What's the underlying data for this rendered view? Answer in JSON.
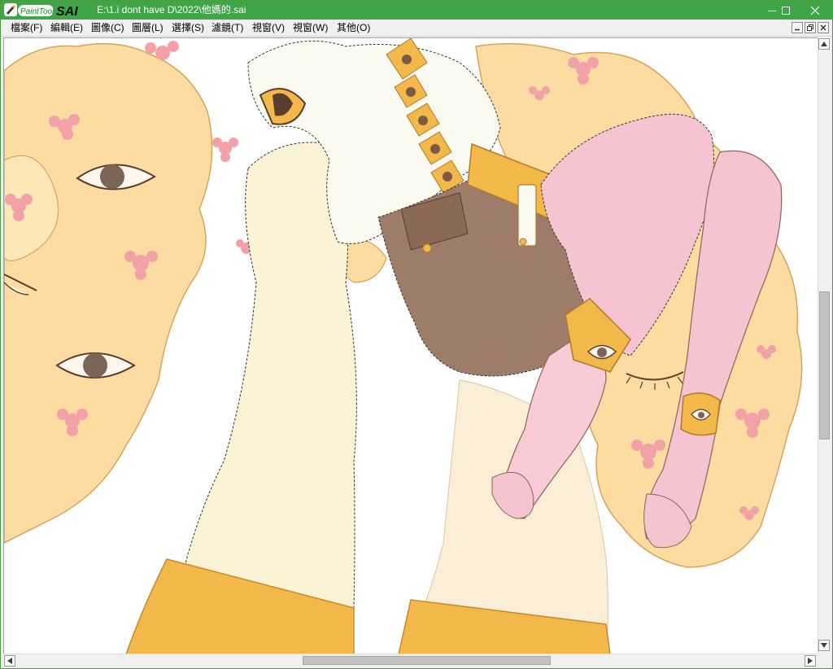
{
  "app": {
    "logo_text": "PaintTool SAI",
    "title": "E:\\1.i dont have D\\2022\\他媽的.sai"
  },
  "window_controls": {
    "minimize_icon": "minimize-icon",
    "maximize_icon": "maximize-icon",
    "close_icon": "close-icon"
  },
  "menu": {
    "items": [
      {
        "label": "檔案(F)"
      },
      {
        "label": "編輯(E)"
      },
      {
        "label": "圖像(C)"
      },
      {
        "label": "圖層(L)"
      },
      {
        "label": "選擇(S)"
      },
      {
        "label": "濾鏡(T)"
      },
      {
        "label": "視窗(V)"
      },
      {
        "label": "視窗(W)"
      },
      {
        "label": "其他(O)"
      }
    ]
  },
  "canvas": {
    "description_icon": "artwork-canvas"
  },
  "scrollbars": {
    "vertical_position": 0.52,
    "horizontal_position": 0.38
  },
  "colors": {
    "titlebar": "#3fa647",
    "skin_pink": "#f6c4d0",
    "hair_yellow": "#fcdca0",
    "gold": "#f2b84a",
    "shorts_brown": "#9d7c69"
  }
}
